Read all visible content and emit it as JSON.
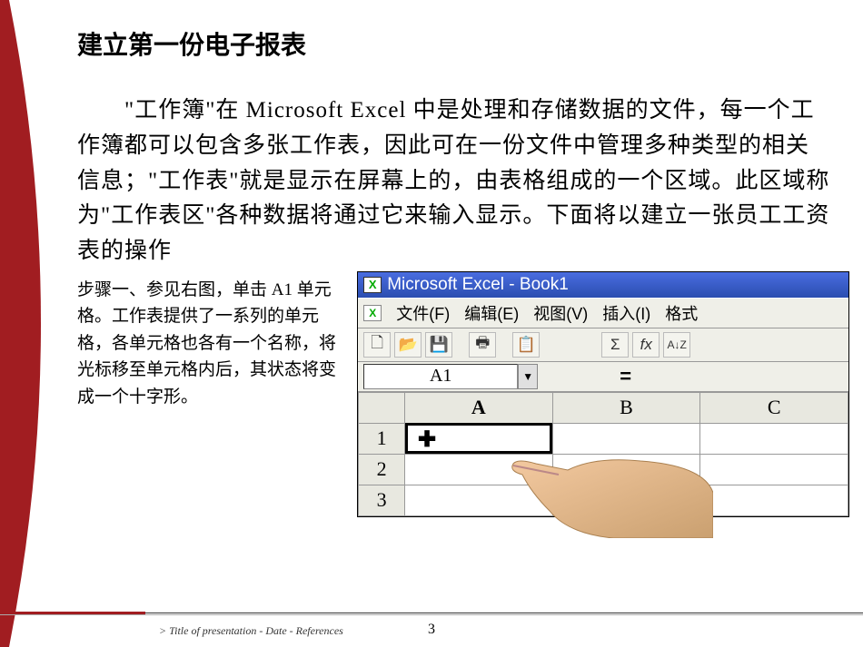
{
  "slide": {
    "title": "建立第一份电子报表",
    "paragraph": "　　\"工作簿\"在  Microsoft Excel  中是处理和存储数据的文件，每一个工作簿都可以包含多张工作表，因此可在一份文件中管理多种类型的相关信息；\"工作表\"就是显示在屏幕上的，由表格组成的一个区域。此区域称为\"工作表区\"各种数据将通过它来输入显示。下面将以建立一张员工工资表的操作",
    "step1": "步骤一、参见右图，单击 A1 单元格。工作表提供了一系列的单元格，各单元格也各有一个名称，将光标移至单元格内后，其状态将变成一个十字形。"
  },
  "excel": {
    "title": "Microsoft Excel - Book1",
    "menu": {
      "file": "文件(F)",
      "edit": "编辑(E)",
      "view": "视图(V)",
      "insert": "插入(I)",
      "format": "格式"
    },
    "tool_icons": {
      "new": "🗋",
      "open": "📂",
      "save": "💾",
      "print": "🖶",
      "paste": "📋",
      "sigma": "Σ",
      "fx": "fx",
      "sort": "A↓Z"
    },
    "namebox": "A1",
    "cols": [
      "A",
      "B",
      "C"
    ],
    "rows": [
      "1",
      "2",
      "3"
    ]
  },
  "footer": {
    "ref": "> Title of presentation - Date - References",
    "page": "3"
  }
}
